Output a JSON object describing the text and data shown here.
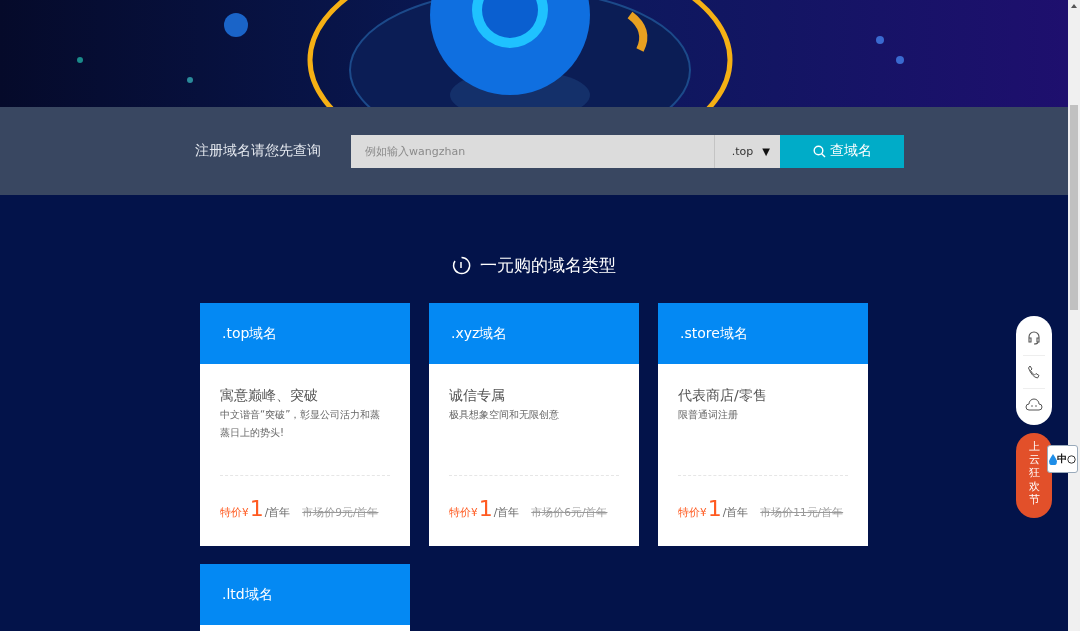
{
  "search": {
    "label": "注册域名请您先查询",
    "placeholder": "例如输入wangzhan",
    "suffix": ".top",
    "caret": "▼",
    "button": "查域名"
  },
  "section": {
    "title": "一元购的域名类型"
  },
  "cards": [
    {
      "title": ".top域名",
      "subtitle": "寓意巅峰、突破",
      "desc": "中文谐音“突破”，彰显公司活力和蒸蒸日上的势头!",
      "price_label": "特价¥",
      "price": "1",
      "unit": "/首年",
      "market": "市场价9元/首年"
    },
    {
      "title": ".xyz域名",
      "subtitle": "诚信专属",
      "desc": "极具想象空间和无限创意",
      "price_label": "特价¥",
      "price": "1",
      "unit": "/首年",
      "market": "市场价6元/首年"
    },
    {
      "title": ".store域名",
      "subtitle": "代表商店/零售",
      "desc": "限普通词注册",
      "price_label": "特价¥",
      "price": "1",
      "unit": "/首年",
      "market": "市场价11元/首年"
    },
    {
      "title": ".ltd域名"
    }
  ],
  "promo": {
    "label": "上云狂欢节"
  },
  "ime": {
    "label": "中"
  }
}
